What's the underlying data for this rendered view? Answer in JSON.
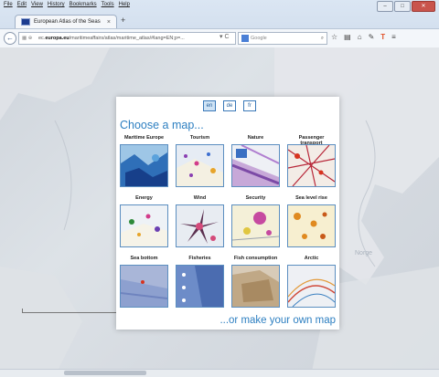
{
  "browser": {
    "menu": [
      "File",
      "Edit",
      "View",
      "History",
      "Bookmarks",
      "Tools",
      "Help"
    ],
    "tab_title": "European Atlas of the Seas",
    "tab_close": "×",
    "new_tab": "+",
    "url_prefix": "ec.",
    "url_domain": "europa.eu",
    "url_rest": "/maritimeaffairs/atlas/maritime_atlas/#lang=EN;p=...",
    "search_placeholder": "Google",
    "window_controls": [
      "–",
      "□",
      "✕"
    ]
  },
  "atlas": {
    "languages": [
      "en",
      "de",
      "fr"
    ],
    "active_language": "en",
    "heading": "Choose a map...",
    "maps": [
      {
        "label": "Maritime Europe"
      },
      {
        "label": "Tourism"
      },
      {
        "label": "Nature"
      },
      {
        "label": "Passenger transport"
      },
      {
        "label": "Energy"
      },
      {
        "label": "Wind"
      },
      {
        "label": "Security"
      },
      {
        "label": "Sea level rise"
      },
      {
        "label": "Sea bottom"
      },
      {
        "label": "Fisheries"
      },
      {
        "label": "Fish consumption"
      },
      {
        "label": "Arctic"
      }
    ],
    "make_own": "...or make your own map"
  },
  "map": {
    "place_label": "Norge"
  }
}
